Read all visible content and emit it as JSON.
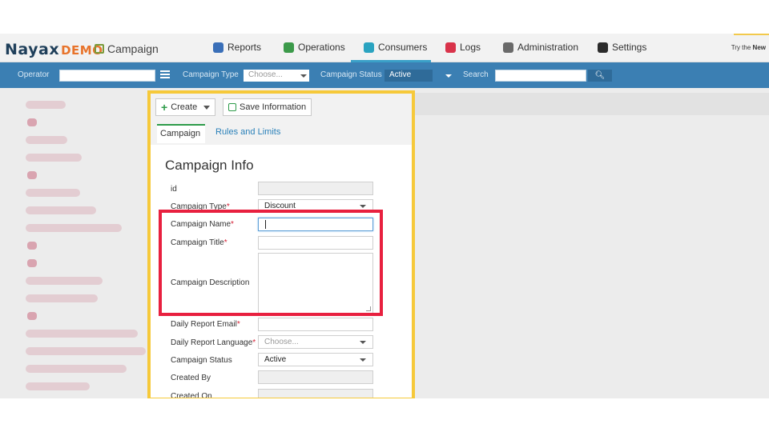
{
  "header": {
    "logo_main": "Nayax",
    "logo_demo": "DEMO",
    "page": "Campaign",
    "nav": [
      {
        "label": "Reports",
        "icon": "chart-icon",
        "color": "#3a6fb8"
      },
      {
        "label": "Operations",
        "icon": "operations-icon",
        "color": "#3c9a4a"
      },
      {
        "label": "Consumers",
        "icon": "consumers-icon",
        "color": "#2aa3c0"
      },
      {
        "label": "Logs",
        "icon": "logs-icon",
        "color": "#d9334a"
      },
      {
        "label": "Administration",
        "icon": "administration-icon",
        "color": "#6a6a6a"
      },
      {
        "label": "Settings",
        "icon": "settings-icon",
        "color": "#2b2b2b"
      }
    ],
    "try_prefix": "Try the",
    "try_bold": "New"
  },
  "filterbar": {
    "operator_label": "Operator",
    "campaign_type_label": "Campaign Type",
    "campaign_type_value": "Choose...",
    "campaign_status_label": "Campaign Status",
    "campaign_status_value": "Active",
    "search_label": "Search",
    "search_icon": "search-icon"
  },
  "panel": {
    "create_label": "Create",
    "save_label": "Save Information",
    "tabs": [
      "Campaign",
      "Rules and Limits"
    ],
    "section_title": "Campaign Info",
    "fields": {
      "id": "id",
      "campaign_type": "Campaign Type",
      "campaign_type_value": "Discount",
      "campaign_name": "Campaign Name",
      "campaign_title": "Campaign Title",
      "campaign_description": "Campaign Description",
      "daily_report_email": "Daily Report Email",
      "daily_report_language": "Daily Report Language",
      "daily_report_language_value": "Choose...",
      "campaign_status": "Campaign Status",
      "campaign_status_value": "Active",
      "created_by": "Created By",
      "created_on": "Created On"
    },
    "required_mark": "*"
  },
  "colors": {
    "accent_blue": "#3b7fb3",
    "highlight_red": "#e8203f",
    "highlight_yellow": "#f6c93a"
  }
}
